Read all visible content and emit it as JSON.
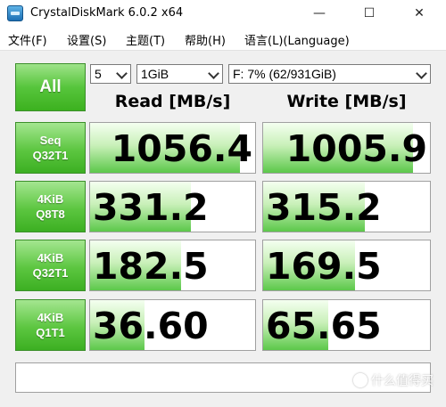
{
  "window": {
    "title": "CrystalDiskMark 6.0.2 x64",
    "minimize_glyph": "—",
    "maximize_glyph": "☐",
    "close_glyph": "✕"
  },
  "menu": {
    "items": [
      {
        "label": "文件(F)"
      },
      {
        "label": "设置(S)"
      },
      {
        "label": "主题(T)"
      },
      {
        "label": "帮助(H)"
      },
      {
        "label": "语言(L)(Language)"
      }
    ]
  },
  "controls": {
    "all_label": "All",
    "runs": "5",
    "size": "1GiB",
    "drive": "F: 7% (62/931GiB)"
  },
  "headers": {
    "read": "Read [MB/s]",
    "write": "Write [MB/s]"
  },
  "tests": [
    {
      "line1": "Seq",
      "line2": "Q32T1",
      "read": "1056.4",
      "write": "1005.9",
      "read_fill": 0.91,
      "write_fill": 0.9
    },
    {
      "line1": "4KiB",
      "line2": "Q8T8",
      "read": "331.2",
      "write": "315.2",
      "read_fill": 0.61,
      "write_fill": 0.61
    },
    {
      "line1": "4KiB",
      "line2": "Q32T1",
      "read": "182.5",
      "write": "169.5",
      "read_fill": 0.55,
      "write_fill": 0.55
    },
    {
      "line1": "4KiB",
      "line2": "Q1T1",
      "read": "36.60",
      "write": "65.65",
      "read_fill": 0.33,
      "write_fill": 0.39
    }
  ],
  "comment": "",
  "watermark": "什么值得买",
  "colors": {
    "accent_green": "#57c53c",
    "fill_green": "#5cc84a"
  }
}
